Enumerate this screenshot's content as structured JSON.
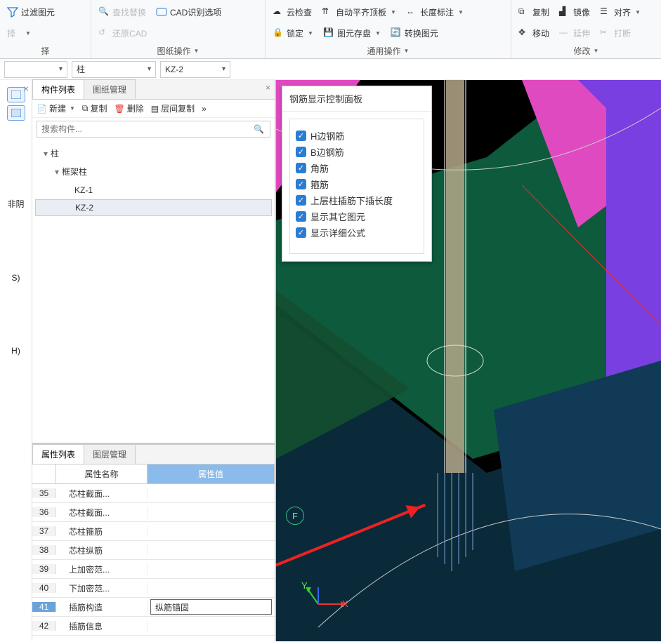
{
  "ribbon": {
    "g0": {
      "filter": "过滤图元",
      "sel_label": "择"
    },
    "g1": {
      "find": "查找替换",
      "cad_opt": "CAD识别选项",
      "restore": "还原CAD",
      "label": "图纸操作"
    },
    "g2": {
      "cloud": "云检查",
      "lock": "锁定",
      "auto_align": "自动平齐顶板",
      "save_el": "图元存盘",
      "len_dim": "长度标注",
      "conv_el": "转换图元",
      "label": "通用操作"
    },
    "g3": {
      "copy": "复制",
      "mirror": "镜像",
      "align": "对齐",
      "move": "移动",
      "extend": "延伸",
      "break": "打断",
      "label": "修改"
    }
  },
  "selectors": {
    "a": "",
    "b": "柱",
    "c": "KZ-2"
  },
  "mid": {
    "tab_list": "构件列表",
    "tab_draw": "图纸管理",
    "btn_new": "新建",
    "btn_copy": "复制",
    "btn_del": "删除",
    "btn_layer": "层间复制",
    "search_ph": "搜索构件...",
    "tree": {
      "root": "柱",
      "sub": "框架柱",
      "kz1": "KZ-1",
      "kz2": "KZ-2"
    }
  },
  "props": {
    "tab_prop": "属性列表",
    "tab_layer": "图层管理",
    "head_name": "属性名称",
    "head_val": "属性值",
    "rows": [
      {
        "n": "35",
        "name": "芯柱截面...",
        "val": ""
      },
      {
        "n": "36",
        "name": "芯柱截面...",
        "val": ""
      },
      {
        "n": "37",
        "name": "芯柱箍筋",
        "val": ""
      },
      {
        "n": "38",
        "name": "芯柱纵筋",
        "val": ""
      },
      {
        "n": "39",
        "name": "上加密范...",
        "val": ""
      },
      {
        "n": "40",
        "name": "下加密范...",
        "val": ""
      },
      {
        "n": "41",
        "name": "插筋构造",
        "val": "纵筋锚固"
      },
      {
        "n": "42",
        "name": "插筋信息",
        "val": ""
      }
    ]
  },
  "panel": {
    "title": "钢筋显示控制面板",
    "items": [
      "H边钢筋",
      "B边钢筋",
      "角筋",
      "箍筋",
      "上层柱插筋下插长度",
      "显示其它图元",
      "显示详细公式"
    ]
  },
  "left": {
    "s": "S)",
    "h": "H)",
    "p": "非阴"
  },
  "view": {
    "axis_f": "F",
    "x": "X",
    "y": "Y"
  }
}
